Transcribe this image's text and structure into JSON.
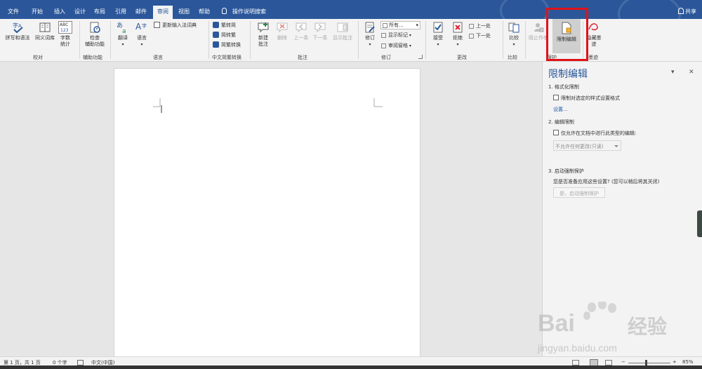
{
  "tabs": [
    {
      "label": "文件",
      "active": false
    },
    {
      "label": "开始",
      "active": false
    },
    {
      "label": "插入",
      "active": false
    },
    {
      "label": "设计",
      "active": false
    },
    {
      "label": "布局",
      "active": false
    },
    {
      "label": "引用",
      "active": false
    },
    {
      "label": "邮件",
      "active": false
    },
    {
      "label": "审阅",
      "active": true
    },
    {
      "label": "视图",
      "active": false
    },
    {
      "label": "帮助",
      "active": false
    }
  ],
  "tell_me": "操作说明搜索",
  "share": "共享",
  "ribbon": {
    "proofing": {
      "spelling": "拼写和语法",
      "thesaurus": "同义词库",
      "word_count_1": "字数",
      "word_count_2": "统计",
      "group": "校对",
      "abc_icon_text": "ABC\n123"
    },
    "accessibility": {
      "check_1": "检查",
      "check_2": "辅助功能",
      "group": "辅助功能"
    },
    "language": {
      "translate": "翻译",
      "language": "语言",
      "update_ime": "更新输入法词典",
      "group": "语言"
    },
    "chinese_conversion": {
      "to_simplified": "繁转简",
      "to_traditional": "简转繁",
      "convert": "简繁转换",
      "group": "中文简繁转换"
    },
    "comments": {
      "new_1": "新建",
      "new_2": "批注",
      "delete": "删除",
      "previous": "上一条",
      "next": "下一条",
      "show": "显示批注",
      "group": "批注"
    },
    "tracking": {
      "track_changes": "修订",
      "all_markup": "所有...",
      "show_markup": "显示标记",
      "reviewing_pane": "审阅窗格",
      "group": "修订"
    },
    "changes": {
      "accept": "接受",
      "reject": "拒绝",
      "previous": "上一处",
      "next": "下一处",
      "group": "更改"
    },
    "compare": {
      "compare": "比较",
      "group": "比较"
    },
    "protect": {
      "block_authors": "阻止作者",
      "restrict_editing": "限制编辑",
      "group": "保护"
    },
    "ink": {
      "hide_ink_1": "隐藏墨",
      "hide_ink_2": "迹",
      "group": "墨迹"
    }
  },
  "pane": {
    "title": "限制编辑",
    "section1_title": "1. 格式化限制",
    "section1_checkbox": "限制对选定的样式设置格式",
    "settings_link": "设置...",
    "section2_title": "2. 编辑限制",
    "section2_checkbox": "仅允许在文档中进行此类型的编辑:",
    "section2_dropdown": "不允许任何更改(只读)",
    "section3_title": "3. 启动强制保护",
    "section3_question": "您是否准备应用这些设置? (您可以稍后将其关闭)",
    "section3_button": "是，启动强制保护",
    "dropdown_icon": "chevron-down-icon",
    "close_icon": "close-icon"
  },
  "status": {
    "page": "第 1 页，共 1 页",
    "words": "0 个字",
    "language": "中文(中国)",
    "zoom": "85%",
    "zoom_minus": "−",
    "zoom_plus": "+"
  },
  "watermark": {
    "brand_left": "Bai",
    "brand_right": "经验",
    "url": "jingyan.baidu.com"
  },
  "colors": {
    "accent": "#2b579a",
    "highlight": "#e01218"
  }
}
